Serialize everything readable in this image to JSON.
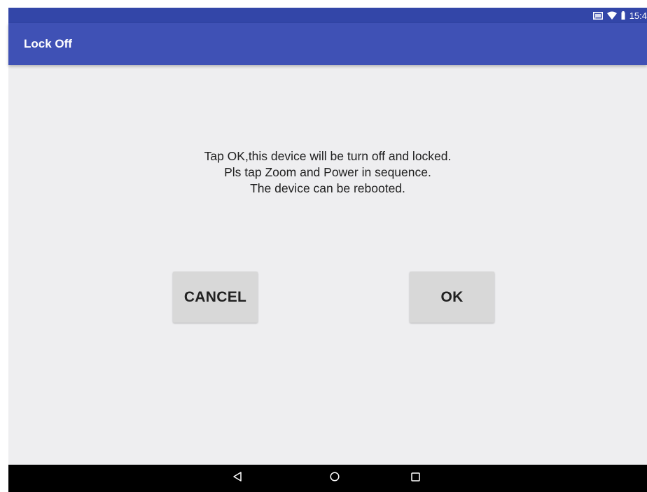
{
  "status_bar": {
    "icons": [
      "cast-icon",
      "wifi-icon",
      "battery-icon"
    ],
    "time": "15:4"
  },
  "app_bar": {
    "title": "Lock Off",
    "color": "#3f51b5"
  },
  "message": {
    "lines": [
      "Tap OK,this device will be turn off and locked.",
      "Pls tap Zoom and Power in sequence.",
      "The device can be rebooted."
    ]
  },
  "buttons": {
    "cancel_label": "CANCEL",
    "ok_label": "OK"
  },
  "nav_bar": {
    "icons": [
      "back-icon",
      "home-icon",
      "recents-icon"
    ]
  }
}
